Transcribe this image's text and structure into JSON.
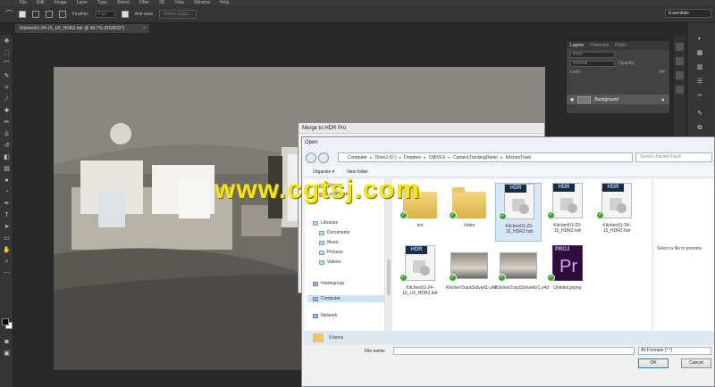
{
  "menubar": [
    "File",
    "Edit",
    "Image",
    "Layer",
    "Type",
    "Select",
    "Filter",
    "3D",
    "View",
    "Window",
    "Help"
  ],
  "options": {
    "feather_label": "Feather:",
    "feather_value": "0 px",
    "antialias_label": "Anti-alias",
    "refine_edge": "Refine Edge...",
    "workspace": "Essentials"
  },
  "document_tab": {
    "title": "Kitchen01-24-15_LR_HDR2.hdr @ 66.7% (RGB/32*)",
    "close": "×"
  },
  "layers_panel": {
    "tabs": [
      "Layers",
      "Channels",
      "Paths"
    ],
    "kind_label": "Kind",
    "blend_mode": "Normal",
    "opacity_label": "Opacity:",
    "lock_label": "Lock:",
    "fill_label": "Fill:",
    "layer_name": "Background"
  },
  "hdr_dialog": {
    "title": "Merge to HDR Pro"
  },
  "open_dialog": {
    "title": "Open",
    "breadcrumbs": [
      "Computer",
      "Drive2 (D:)",
      "Dropbox",
      "CMIVFX",
      "CameraTrackingDemo",
      "KitchenTrack"
    ],
    "search_placeholder": "Search KitchenTrack",
    "organize": "Organize ▾",
    "new_folder": "New folder",
    "nav_items": [
      {
        "label": "Dragon",
        "type": "folder"
      },
      {
        "label": "Local Disk",
        "type": "folder"
      },
      {
        "label": "Libraries",
        "type": "lib",
        "head": true
      },
      {
        "label": "Documents",
        "type": "lib"
      },
      {
        "label": "Music",
        "type": "lib"
      },
      {
        "label": "Pictures",
        "type": "lib"
      },
      {
        "label": "Videos",
        "type": "lib"
      },
      {
        "label": "Homegroup",
        "type": "pc",
        "head": true
      },
      {
        "label": "Computer",
        "type": "pc",
        "head": true
      },
      {
        "label": "Network",
        "type": "pc",
        "head": true
      }
    ],
    "files": [
      {
        "name": "tex",
        "kind": "folder"
      },
      {
        "name": "Video",
        "kind": "folder"
      },
      {
        "name": "Kitchen01-23-15_HDR2.hdr",
        "kind": "hdr",
        "selected": true
      },
      {
        "name": "Kitchen01-23-15_HDR2.hdr",
        "kind": "hdr"
      },
      {
        "name": "Kitchen01-24-15_HDR2.hdr",
        "kind": "hdr"
      },
      {
        "name": "Kitchen01-24-15_LR_HDR2.hdr",
        "kind": "hdr"
      },
      {
        "name": "KitchenTrackSolved1.c4d",
        "kind": "photo"
      },
      {
        "name": "KitchenTrackSolvedV1.c4d",
        "kind": "photo"
      },
      {
        "name": "Untitled.prproj",
        "kind": "proj"
      }
    ],
    "hdr_badge": "HDR",
    "proj_badge": "PROJ",
    "proj_letter": "Pr",
    "preview_message": "Select a file to preview.",
    "item_count": "9 items",
    "file_name_label": "File name:",
    "file_name_value": "",
    "filter": "All Formats (*.*)",
    "ok": "OK",
    "cancel": "Cancel"
  },
  "watermark": "www.cgtsj.com"
}
